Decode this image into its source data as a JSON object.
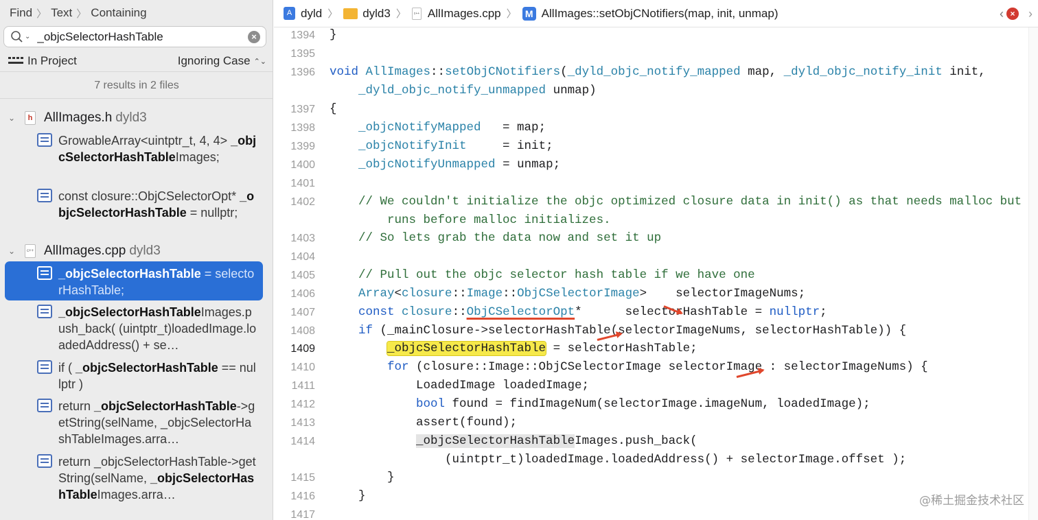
{
  "navigator": {
    "breadcrumb": [
      "Find",
      "Text",
      "Containing"
    ],
    "search_value": "_objcSelectorHashTable",
    "scope_label": "In Project",
    "case_label": "Ignoring Case",
    "summary": "7 results in 2 files",
    "files": [
      {
        "name": "AllImages.h",
        "project": "dyld3",
        "icon": "h"
      },
      {
        "name": "AllImages.cpp",
        "project": "dyld3",
        "icon": "c++"
      }
    ],
    "results": [
      {
        "pre": "GrowableArray<uintptr_t, 4, 4> ",
        "match": "_objcSelectorHashTable",
        "post": "Images;"
      },
      {
        "pre": "const closure::ObjCSelectorOpt*                 ",
        "match": "_objcSelectorHashTable",
        "post": "       = nullptr;"
      },
      {
        "pre": "",
        "match": "_objcSelectorHashTable",
        "post": " = selectorHashTable;"
      },
      {
        "pre": "",
        "match": "_objcSelectorHashTable",
        "post": "Images.push_back( (uintptr_t)loadedImage.loadedAddress() + se…"
      },
      {
        "pre": "if ( ",
        "match": "_objcSelectorHashTable",
        "post": " == nullptr )"
      },
      {
        "pre": "return ",
        "match": "_objcSelectorHashTable",
        "post": "->getString(selName, _objcSelectorHashTableImages.arra…"
      },
      {
        "pre": "return _objcSelectorHashTable->getString(selName, ",
        "match": "_objcSelectorHashTable",
        "post": "Images.arra…"
      }
    ]
  },
  "jumpbar": {
    "project": "dyld",
    "folder": "dyld3",
    "file": "AllImages.cpp",
    "method": "AllImages::setObjCNotifiers(map, init, unmap)",
    "method_icon": "M"
  },
  "code": {
    "line_numbers": [
      "1394",
      "1395",
      "1396",
      "1397",
      "1398",
      "1399",
      "1400",
      "1401",
      "1402",
      "1403",
      "1404",
      "1405",
      "1406",
      "1407",
      "1408",
      "1409",
      "1410",
      "1411",
      "1412",
      "1413",
      "1414",
      "1415",
      "1416",
      "1417"
    ],
    "current_line": "1409"
  },
  "watermark": "@稀土掘金技术社区",
  "colors": {
    "keyword": "#1f5cc4",
    "type": "#2a82a8",
    "comment": "#2f6e3a",
    "selection": "#2a6fd6",
    "annotation": "#e0472c"
  }
}
